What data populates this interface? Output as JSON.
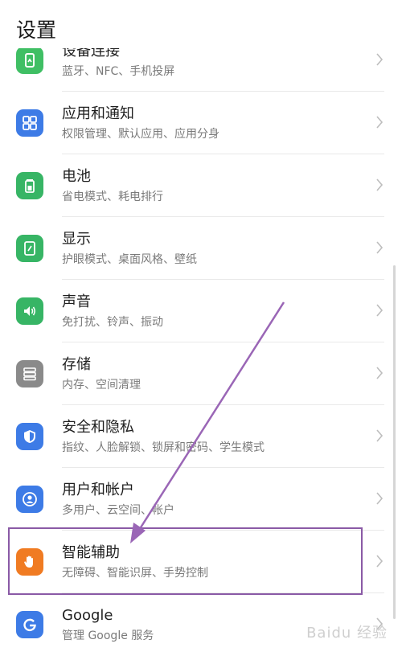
{
  "header": {
    "title": "设置"
  },
  "items": [
    {
      "label": "设备连接",
      "sub": "蓝牙、NFC、手机投屏",
      "icon": "device-connection-icon",
      "color": "#3fbf64"
    },
    {
      "label": "应用和通知",
      "sub": "权限管理、默认应用、应用分身",
      "icon": "apps-icon",
      "color": "#3d7be6"
    },
    {
      "label": "电池",
      "sub": "省电模式、耗电排行",
      "icon": "battery-icon",
      "color": "#37b565"
    },
    {
      "label": "显示",
      "sub": "护眼模式、桌面风格、壁纸",
      "icon": "display-icon",
      "color": "#37b565"
    },
    {
      "label": "声音",
      "sub": "免打扰、铃声、振动",
      "icon": "sound-icon",
      "color": "#37b565"
    },
    {
      "label": "存储",
      "sub": "内存、空间清理",
      "icon": "storage-icon",
      "color": "#8a8a8a"
    },
    {
      "label": "安全和隐私",
      "sub": "指纹、人脸解锁、锁屏和密码、学生模式",
      "icon": "security-shield-icon",
      "color": "#3d7be6"
    },
    {
      "label": "用户和帐户",
      "sub": "多用户、云空间、帐户",
      "icon": "user-account-icon",
      "color": "#3d7be6"
    },
    {
      "label": "智能辅助",
      "sub": "无障碍、智能识屏、手势控制",
      "icon": "hand-icon",
      "color": "#f07b22"
    },
    {
      "label": "Google",
      "sub": "管理 Google 服务",
      "icon": "google-icon",
      "color": "#3d7be6"
    }
  ],
  "watermark": {
    "text": "Baidu 经验"
  },
  "colors": {
    "highlight": "#8a5aa6",
    "arrow": "#9a66b6"
  }
}
